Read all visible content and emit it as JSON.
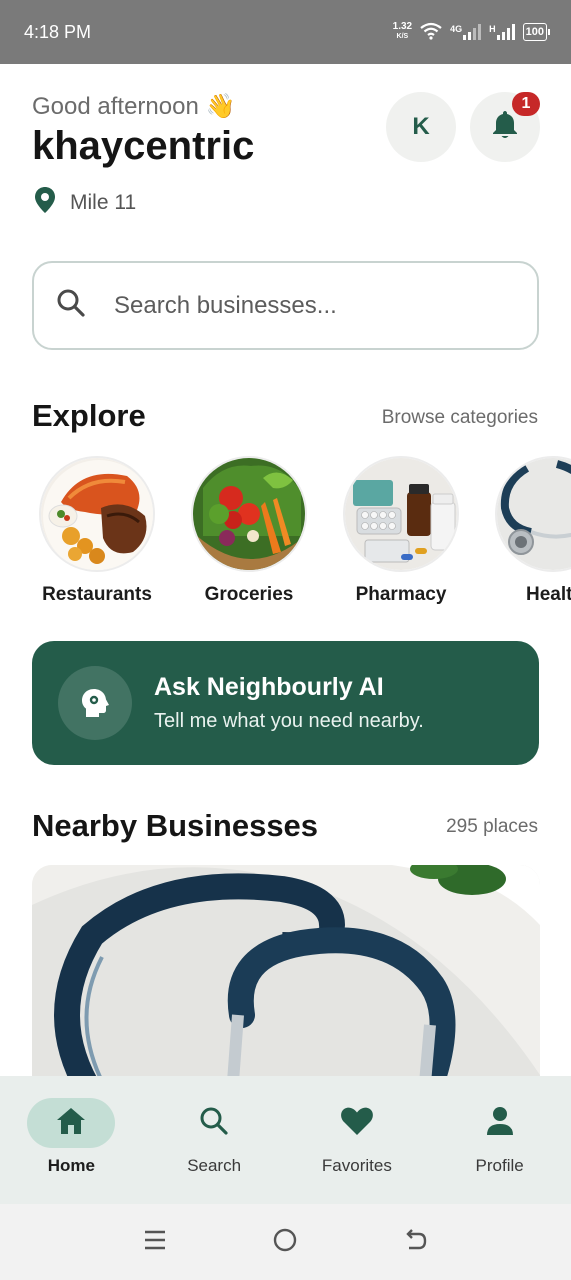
{
  "status_bar": {
    "time": "4:18 PM",
    "speed_value": "1.32",
    "speed_unit": "K/S",
    "network_label": "4G",
    "network_label_2": "H",
    "battery": "100"
  },
  "header": {
    "greeting": "Good afternoon 👋",
    "username": "khaycentric",
    "location": "Mile 11",
    "avatar_initial": "K",
    "notification_count": "1"
  },
  "search": {
    "placeholder": "Search businesses..."
  },
  "explore": {
    "title": "Explore",
    "link": "Browse categories",
    "categories": [
      {
        "label": "Restaurants"
      },
      {
        "label": "Groceries"
      },
      {
        "label": "Pharmacy"
      },
      {
        "label": "Healt"
      }
    ]
  },
  "ai_banner": {
    "title": "Ask Neighbourly AI",
    "subtitle": "Tell me what you need nearby."
  },
  "nearby": {
    "title": "Nearby Businesses",
    "count": "295 places"
  },
  "bottom_nav": {
    "items": [
      {
        "label": "Home",
        "icon": "home-icon",
        "active": true
      },
      {
        "label": "Search",
        "icon": "search-icon",
        "active": false
      },
      {
        "label": "Favorites",
        "icon": "heart-icon",
        "active": false
      },
      {
        "label": "Profile",
        "icon": "person-icon",
        "active": false
      }
    ]
  },
  "colors": {
    "brand_green": "#245c4a",
    "badge_red": "#c62828",
    "active_pill": "#c4ded5"
  }
}
